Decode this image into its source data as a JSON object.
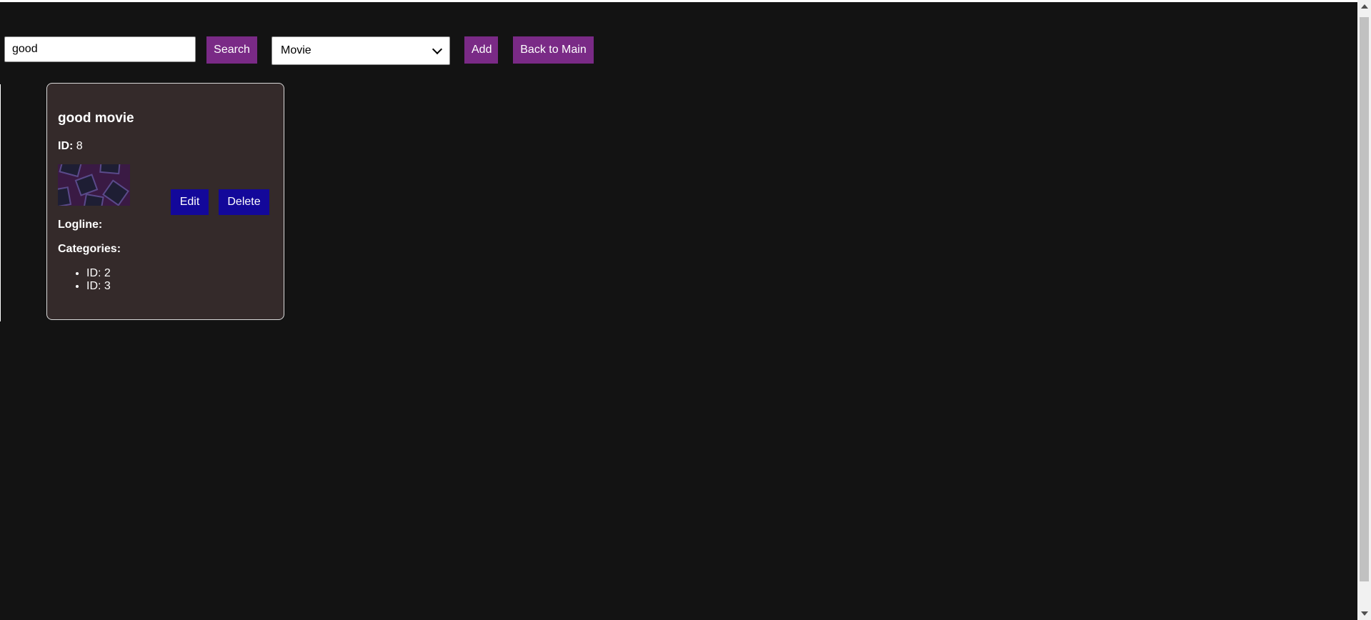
{
  "toolbar": {
    "search_value": "good",
    "search_label": "Search",
    "type_selected": "Movie",
    "add_label": "Add",
    "back_label": "Back to Main"
  },
  "card": {
    "title": "good movie",
    "id_label": "ID:",
    "id_value": "8",
    "edit_label": "Edit",
    "delete_label": "Delete",
    "logline_label": "Logline:",
    "categories_label": "Categories:",
    "categories": [
      "ID: 2",
      "ID: 3"
    ]
  },
  "colors": {
    "background": "#131313",
    "card_bg": "#342a2a",
    "purple_button": "#7a2a86",
    "blue_button": "#13089a"
  }
}
